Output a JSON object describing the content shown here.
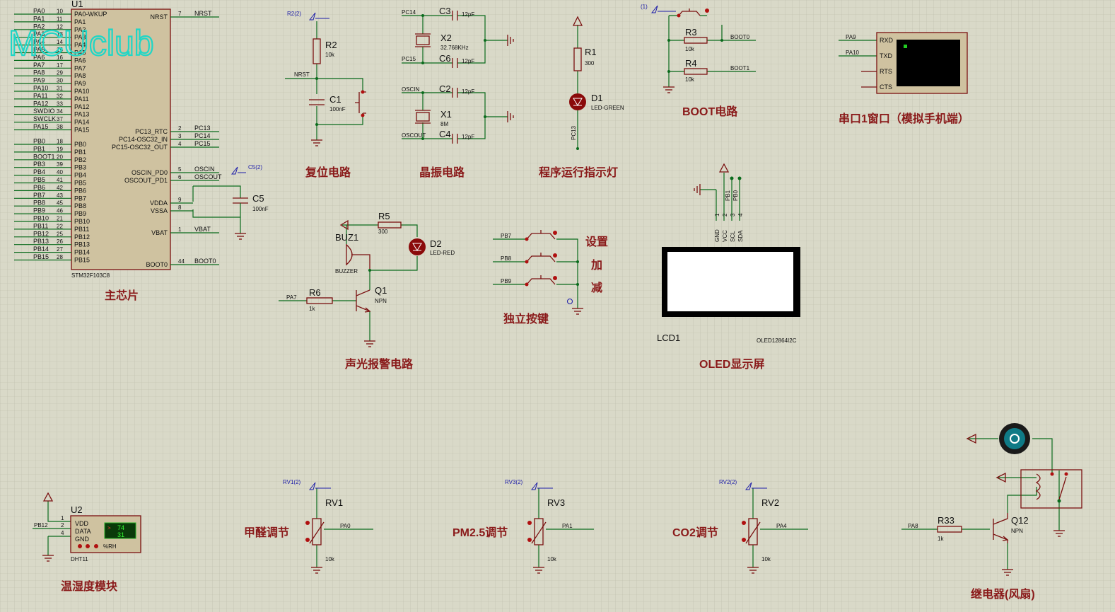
{
  "watermark": "MCUclub",
  "sections": {
    "main": "主芯片",
    "reset": "复位电路",
    "crystal": "晶振电路",
    "indicator": "程序运行指示灯",
    "boot": "BOOT电路",
    "uart": "串口1窗口（模拟手机端）",
    "alarm": "声光报警电路",
    "keys": "独立按键",
    "oled": "OLED显示屏",
    "dht": "温湿度模块",
    "hcho": "甲醛调节",
    "pm25": "PM2.5调节",
    "co2": "CO2调节",
    "relay": "继电器(风扇)"
  },
  "u1": {
    "ref": "U1",
    "part": "STM32F103C8",
    "left_pins": [
      {
        "net": "PA0",
        "num": "10",
        "name": "PA0-WKUP"
      },
      {
        "net": "PA1",
        "num": "11",
        "name": "PA1"
      },
      {
        "net": "PA2",
        "num": "12",
        "name": "PA2"
      },
      {
        "net": "PA3",
        "num": "13",
        "name": "PA3"
      },
      {
        "net": "PA4",
        "num": "14",
        "name": "PA4"
      },
      {
        "net": "PA5",
        "num": "15",
        "name": "PA5"
      },
      {
        "net": "PA6",
        "num": "16",
        "name": "PA6"
      },
      {
        "net": "PA7",
        "num": "17",
        "name": "PA7"
      },
      {
        "net": "PA8",
        "num": "29",
        "name": "PA8"
      },
      {
        "net": "PA9",
        "num": "30",
        "name": "PA9"
      },
      {
        "net": "PA10",
        "num": "31",
        "name": "PA10"
      },
      {
        "net": "PA11",
        "num": "32",
        "name": "PA11"
      },
      {
        "net": "PA12",
        "num": "33",
        "name": "PA12"
      },
      {
        "net": "SWDIO",
        "num": "34",
        "name": "PA13"
      },
      {
        "net": "SWCLK",
        "num": "37",
        "name": "PA14"
      },
      {
        "net": "PA15",
        "num": "38",
        "name": "PA15"
      },
      {
        "net": "PB0",
        "num": "18",
        "name": "PB0"
      },
      {
        "net": "PB1",
        "num": "19",
        "name": "PB1"
      },
      {
        "net": "BOOT1",
        "num": "20",
        "name": "PB2"
      },
      {
        "net": "PB3",
        "num": "39",
        "name": "PB3"
      },
      {
        "net": "PB4",
        "num": "40",
        "name": "PB4"
      },
      {
        "net": "PB5",
        "num": "41",
        "name": "PB5"
      },
      {
        "net": "PB6",
        "num": "42",
        "name": "PB6"
      },
      {
        "net": "PB7",
        "num": "43",
        "name": "PB7"
      },
      {
        "net": "PB8",
        "num": "45",
        "name": "PB8"
      },
      {
        "net": "PB9",
        "num": "46",
        "name": "PB9"
      },
      {
        "net": "PB10",
        "num": "21",
        "name": "PB10"
      },
      {
        "net": "PB11",
        "num": "22",
        "name": "PB11"
      },
      {
        "net": "PB12",
        "num": "25",
        "name": "PB12"
      },
      {
        "net": "PB13",
        "num": "26",
        "name": "PB13"
      },
      {
        "net": "PB14",
        "num": "27",
        "name": "PB14"
      },
      {
        "net": "PB15",
        "num": "28",
        "name": "PB15"
      }
    ],
    "right_pins": [
      {
        "name": "NRST",
        "num": "7",
        "net": "NRST"
      },
      {
        "name": "PC13_RTC",
        "num": "2",
        "net": "PC13"
      },
      {
        "name": "PC14-OSC32_IN",
        "num": "3",
        "net": "PC14"
      },
      {
        "name": "PC15-OSC32_OUT",
        "num": "4",
        "net": "PC15"
      },
      {
        "name": "OSCIN_PD0",
        "num": "5",
        "net": "OSCIN"
      },
      {
        "name": "OSCOUT_PD1",
        "num": "6",
        "net": "OSCOUT"
      },
      {
        "name": "VDDA",
        "num": "9",
        "net": ""
      },
      {
        "name": "VSSA",
        "num": "8",
        "net": ""
      },
      {
        "name": "VBAT",
        "num": "1",
        "net": "VBAT"
      },
      {
        "name": "BOOT0",
        "num": "44",
        "net": "BOOT0"
      }
    ]
  },
  "c5": {
    "ref": "C5",
    "val": "100nF",
    "probe": "C5(2)"
  },
  "reset": {
    "r_ref": "R2",
    "r_val": "10k",
    "c_ref": "C1",
    "c_val": "100nF",
    "net": "NRST",
    "probe": "R2(2)"
  },
  "crystal": {
    "c3": "C3",
    "c3v": "12pF",
    "x2": "X2",
    "x2v": "32.768KHz",
    "c6": "C6",
    "c6v": "12pF",
    "pc14": "PC14",
    "pc15": "PC15",
    "c2": "C2",
    "c2v": "12pF",
    "x1": "X1",
    "x1v": "8M",
    "c4": "C4",
    "c4v": "12pF",
    "oscin": "OSCIN",
    "oscout": "OSCOUT"
  },
  "led": {
    "r_ref": "R1",
    "r_val": "300",
    "d_ref": "D1",
    "d_val": "LED-GREEN",
    "net": "PC13"
  },
  "boot": {
    "probe": "(1)",
    "r3": "R3",
    "r3v": "10k",
    "r4": "R4",
    "r4v": "10k",
    "boot0": "BOOT0",
    "boot1": "BOOT1"
  },
  "uart": {
    "pa9": "PA9",
    "pa10": "PA10",
    "pins": [
      "RXD",
      "TXD",
      "RTS",
      "CTS"
    ]
  },
  "alarm": {
    "r5": "R5",
    "r5v": "300",
    "d2": "D2",
    "d2v": "LED-RED",
    "buz": "BUZ1",
    "buzv": "BUZZER",
    "r6": "R6",
    "r6v": "1k",
    "q1": "Q1",
    "q1v": "NPN",
    "pa7": "PA7"
  },
  "keys": {
    "nets": [
      "PB7",
      "PB8",
      "PB9"
    ],
    "labels": [
      "设置",
      "加",
      "减"
    ]
  },
  "oled": {
    "ref": "LCD1",
    "part": "OLED12864I2C",
    "pins": [
      "GND",
      "VCC",
      "SCL",
      "SDA"
    ],
    "nums": [
      "1",
      "2",
      "3",
      "4"
    ],
    "nets": [
      "PB1",
      "PB0"
    ]
  },
  "dht": {
    "ref": "U2",
    "part": "DHT11",
    "pins": [
      "VDD",
      "DATA",
      "GND"
    ],
    "nums": [
      "1",
      "2",
      "4"
    ],
    "net": "PB12",
    "temp": "74",
    "hum": "31",
    "unit": "%RH"
  },
  "rv1": {
    "probe": "RV1(2)",
    "ref": "RV1",
    "val": "10k",
    "net": "PA0"
  },
  "rv3": {
    "probe": "RV3(2)",
    "ref": "RV3",
    "val": "10k",
    "net": "PA1"
  },
  "rv2": {
    "probe": "RV2(2)",
    "ref": "RV2",
    "val": "10k",
    "net": "PA4"
  },
  "relay": {
    "r": "R33",
    "rv": "1k",
    "q": "Q12",
    "qv": "NPN",
    "net": "PA8"
  }
}
